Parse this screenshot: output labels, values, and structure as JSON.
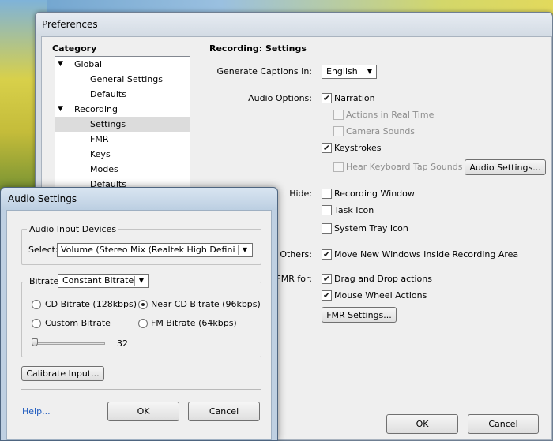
{
  "preferences": {
    "title": "Preferences",
    "category_label": "Category",
    "tree": [
      {
        "label": "Global",
        "level": 0,
        "expanded": true
      },
      {
        "label": "General Settings",
        "level": 1
      },
      {
        "label": "Defaults",
        "level": 1
      },
      {
        "label": "Recording",
        "level": 0,
        "expanded": true
      },
      {
        "label": "Settings",
        "level": 1,
        "selected": true
      },
      {
        "label": "FMR",
        "level": 1
      },
      {
        "label": "Keys",
        "level": 1
      },
      {
        "label": "Modes",
        "level": 1
      },
      {
        "label": "Defaults",
        "level": 1
      }
    ],
    "section_title": "Recording: Settings",
    "captions_label": "Generate Captions In:",
    "captions_value": "English",
    "audio_options_label": "Audio Options:",
    "narration": {
      "label": "Narration",
      "checked": true
    },
    "actions_realtime": {
      "label": "Actions in Real Time",
      "checked": false,
      "disabled": true
    },
    "camera_sounds": {
      "label": "Camera Sounds",
      "checked": false,
      "disabled": true
    },
    "keystrokes": {
      "label": "Keystrokes",
      "checked": true
    },
    "hear_keyboard": {
      "label": "Hear Keyboard Tap Sounds",
      "checked": false,
      "disabled": true
    },
    "audio_settings_button": "Audio Settings...",
    "hide_label": "Hide:",
    "recording_window": {
      "label": "Recording Window",
      "checked": false
    },
    "task_icon": {
      "label": "Task Icon",
      "checked": false
    },
    "system_tray_icon": {
      "label": "System Tray Icon",
      "checked": false
    },
    "others_label": "Others:",
    "move_windows": {
      "label": "Move New Windows Inside Recording Area",
      "checked": true
    },
    "fmr_for_label": "FMR for:",
    "drag_drop": {
      "label": "Drag and Drop actions",
      "checked": true
    },
    "mouse_wheel": {
      "label": "Mouse Wheel Actions",
      "checked": true
    },
    "fmr_settings_button": "FMR Settings...",
    "ok_button": "OK",
    "cancel_button": "Cancel"
  },
  "audio_settings": {
    "title": "Audio Settings",
    "input_group_label": "Audio Input Devices",
    "select_label": "Select:",
    "device_value": "Volume (Stereo Mix (Realtek High Defini",
    "bitrate_label": "Bitrate",
    "bitrate_mode": "Constant Bitrate",
    "radios": [
      {
        "label": "CD Bitrate (128kbps)",
        "checked": false
      },
      {
        "label": "Near CD Bitrate (96kbps)",
        "checked": true
      },
      {
        "label": "Custom Bitrate",
        "checked": false
      },
      {
        "label": "FM Bitrate (64kbps)",
        "checked": false
      }
    ],
    "slider_value": "32",
    "calibrate_button": "Calibrate Input...",
    "help_link": "Help...",
    "ok_button": "OK",
    "cancel_button": "Cancel"
  },
  "check_glyph": "✔"
}
